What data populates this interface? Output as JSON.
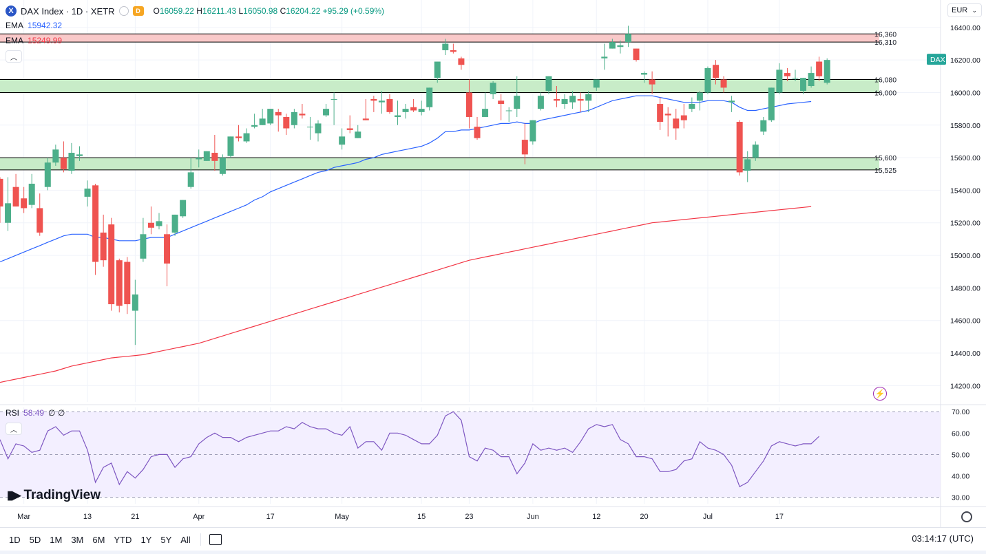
{
  "header": {
    "symbol_icon": "x-badge-icon",
    "title": "DAX Index · 1D · XETR",
    "delay_badge": "D",
    "open_label": "O",
    "open": "16059.22",
    "high_label": "H",
    "high": "16211.43",
    "low_label": "L",
    "low": "16050.98",
    "close_label": "C",
    "close": "16204.22",
    "change": "+95.29 (+0.59%)"
  },
  "legend": {
    "ema_fast_name": "EMA",
    "ema_fast_value": "15942.32",
    "ema_slow_name": "EMA",
    "ema_slow_value": "15249.99",
    "rsi_name": "RSI",
    "rsi_value": "58.49",
    "rsi_extra": "∅ ∅"
  },
  "currency": "EUR",
  "toolbar": {
    "timeframes": [
      "1D",
      "5D",
      "1M",
      "3M",
      "6M",
      "YTD",
      "1Y",
      "5Y",
      "All"
    ],
    "clock": "03:14:17 (UTC)"
  },
  "brand": "TradingView",
  "colors": {
    "up": "#26a69a",
    "up_body": "#4caf8a",
    "down": "#ef5350",
    "ema_fast": "#2962ff",
    "ema_slow": "#f23645",
    "rsi": "#7e57c2",
    "zone_support": "#c8ecc8",
    "zone_resistance": "#f9c9c9"
  },
  "chart_data": {
    "type": "candlestick",
    "ylim": [
      14100,
      16450
    ],
    "yticks": [
      14200,
      14400,
      14600,
      14800,
      15000,
      15200,
      15400,
      15600,
      15800,
      16000,
      16200,
      16400
    ],
    "ytick_labels": [
      "14200.00",
      "14400.00",
      "14600.00",
      "14800.00",
      "15000.00",
      "15200.00",
      "15400.00",
      "15600.00",
      "15800.00",
      "16000.00",
      "16200.00",
      "16400.00"
    ],
    "last_price_tag": "DAX",
    "xtick_labels": [
      "Mar",
      "13",
      "21",
      "Apr",
      "17",
      "May",
      "15",
      "23",
      "Jun",
      "12",
      "20",
      "Jul",
      "17"
    ],
    "xtick_bar_index": [
      3,
      11,
      17,
      25,
      34,
      43,
      53,
      59,
      67,
      75,
      81,
      89,
      98
    ],
    "levels": [
      {
        "label": "16,360",
        "value": 16360
      },
      {
        "label": "16,310",
        "value": 16310
      },
      {
        "label": "16,080",
        "value": 16080
      },
      {
        "label": "16,000",
        "value": 16000
      },
      {
        "label": "15,600",
        "value": 15600
      },
      {
        "label": "15,525",
        "value": 15525
      }
    ],
    "zones": [
      {
        "kind": "resistance",
        "from": 16310,
        "to": 16360
      },
      {
        "kind": "support",
        "from": 16000,
        "to": 16080
      },
      {
        "kind": "support",
        "from": 15525,
        "to": 15600
      }
    ],
    "candles": [
      [
        15470,
        15480,
        15300,
        15200
      ],
      [
        15200,
        15480,
        15320,
        15150
      ],
      [
        15420,
        15500,
        15300,
        15380
      ],
      [
        15350,
        15420,
        15290,
        15260
      ],
      [
        15310,
        15500,
        15440,
        15290
      ],
      [
        15290,
        15380,
        15140,
        15120
      ],
      [
        15420,
        15600,
        15570,
        15400
      ],
      [
        15570,
        15680,
        15650,
        15550
      ],
      [
        15600,
        15700,
        15530,
        15510
      ],
      [
        15520,
        15690,
        15630,
        15500
      ],
      [
        15610,
        15670,
        15620,
        15580
      ],
      [
        15360,
        15460,
        15410,
        15300
      ],
      [
        15430,
        15440,
        14960,
        14880
      ],
      [
        15140,
        15250,
        14970,
        14930
      ],
      [
        15190,
        15230,
        14700,
        14660
      ],
      [
        14970,
        14980,
        14690,
        14650
      ],
      [
        14960,
        14990,
        14700,
        14640
      ],
      [
        14660,
        14850,
        14760,
        14450
      ],
      [
        14980,
        15230,
        15130,
        14960
      ],
      [
        15200,
        15300,
        15170,
        15130
      ],
      [
        15180,
        15260,
        15210,
        15160
      ],
      [
        15130,
        15190,
        14950,
        14810
      ],
      [
        15140,
        15230,
        15250,
        15120
      ],
      [
        15240,
        15320,
        15340,
        15230
      ],
      [
        15420,
        15600,
        15510,
        15410
      ],
      [
        15590,
        15650,
        15600,
        15540
      ],
      [
        15580,
        15610,
        15640,
        15580
      ],
      [
        15630,
        15740,
        15580,
        15520
      ],
      [
        15500,
        15620,
        15600,
        15490
      ],
      [
        15610,
        15680,
        15730,
        15600
      ],
      [
        15730,
        15800,
        15720,
        15700
      ],
      [
        15700,
        15780,
        15750,
        15690
      ],
      [
        15790,
        15870,
        15800,
        15780
      ],
      [
        15800,
        15900,
        15840,
        15810
      ],
      [
        15810,
        15890,
        15900,
        15800
      ],
      [
        15880,
        15900,
        15860,
        15760
      ],
      [
        15850,
        15870,
        15780,
        15740
      ],
      [
        15800,
        15900,
        15880,
        15780
      ],
      [
        15870,
        15930,
        15860,
        15840
      ],
      [
        15790,
        15850,
        15790,
        15710
      ],
      [
        15750,
        15830,
        15810,
        15700
      ],
      [
        15860,
        15930,
        15900,
        15850
      ],
      [
        15960,
        16000,
        15960,
        15800
      ],
      [
        15680,
        15780,
        15730,
        15650
      ],
      [
        15780,
        15860,
        15770,
        15750
      ],
      [
        15720,
        15800,
        15760,
        15720
      ],
      [
        15840,
        15960,
        15830,
        15830
      ],
      [
        15960,
        15980,
        15950,
        15880
      ],
      [
        15940,
        16010,
        15950,
        15870
      ],
      [
        15960,
        15990,
        15880,
        15870
      ],
      [
        15850,
        15950,
        15860,
        15800
      ],
      [
        15880,
        15930,
        15900,
        15840
      ],
      [
        15910,
        15960,
        15890,
        15880
      ],
      [
        15880,
        15950,
        15900,
        15860
      ],
      [
        15910,
        15990,
        16030,
        15890
      ],
      [
        16090,
        16150,
        16190,
        16060
      ],
      [
        16260,
        16330,
        16300,
        16230
      ],
      [
        16260,
        16300,
        16250,
        16240
      ],
      [
        16210,
        16220,
        16170,
        16140
      ],
      [
        16000,
        16080,
        15850,
        15780
      ],
      [
        15790,
        15850,
        15720,
        15710
      ],
      [
        15850,
        16000,
        15900,
        15850
      ],
      [
        15990,
        16070,
        16060,
        15960
      ],
      [
        15950,
        15990,
        15930,
        15830
      ],
      [
        15890,
        15910,
        15890,
        15820
      ],
      [
        15900,
        16100,
        15980,
        15850
      ],
      [
        15710,
        15810,
        15620,
        15560
      ],
      [
        15700,
        15780,
        15830,
        15680
      ],
      [
        15900,
        16000,
        15980,
        15890
      ],
      [
        16010,
        16090,
        16100,
        15990
      ],
      [
        15960,
        16040,
        15950,
        15910
      ],
      [
        15930,
        15990,
        15960,
        15900
      ],
      [
        15940,
        16010,
        15980,
        15900
      ],
      [
        15960,
        16000,
        15950,
        15880
      ],
      [
        15950,
        16010,
        15990,
        15880
      ],
      [
        16030,
        16080,
        16080,
        16010
      ],
      [
        16210,
        16300,
        16220,
        16140
      ],
      [
        16270,
        16330,
        16310,
        16270
      ],
      [
        16280,
        16320,
        16290,
        16240
      ],
      [
        16310,
        16410,
        16360,
        16280
      ],
      [
        16270,
        16260,
        16200,
        16190
      ],
      [
        16110,
        16130,
        16120,
        16060
      ],
      [
        16080,
        16130,
        16050,
        15990
      ],
      [
        15930,
        15970,
        15820,
        15770
      ],
      [
        15870,
        15910,
        15860,
        15730
      ],
      [
        15840,
        15900,
        15780,
        15710
      ],
      [
        15860,
        15930,
        15830,
        15780
      ],
      [
        15900,
        15970,
        15930,
        15880
      ],
      [
        15950,
        16010,
        16000,
        15890
      ],
      [
        16000,
        16160,
        16150,
        15990
      ],
      [
        16170,
        16200,
        16090,
        16050
      ],
      [
        16080,
        16100,
        16030,
        16000
      ],
      [
        15940,
        15980,
        15950,
        15880
      ],
      [
        15820,
        15830,
        15510,
        15490
      ],
      [
        15520,
        15640,
        15590,
        15450
      ],
      [
        15600,
        15700,
        15680,
        15580
      ],
      [
        15760,
        15850,
        15830,
        15740
      ],
      [
        15830,
        16010,
        16030,
        15820
      ],
      [
        16000,
        16180,
        16140,
        15990
      ],
      [
        16120,
        16150,
        16100,
        16070
      ],
      [
        16090,
        16140,
        16090,
        16070
      ],
      [
        16010,
        16080,
        16090,
        15990
      ],
      [
        16040,
        16160,
        16120,
        16030
      ],
      [
        16190,
        16220,
        16100,
        16070
      ],
      [
        16060,
        16210,
        16200,
        16050
      ]
    ],
    "ema_fast": [
      14960,
      14980,
      15000,
      15020,
      15040,
      15060,
      15080,
      15100,
      15120,
      15130,
      15130,
      15130,
      15110,
      15110,
      15100,
      15090,
      15090,
      15090,
      15100,
      15110,
      15110,
      15110,
      15130,
      15150,
      15170,
      15190,
      15210,
      15230,
      15250,
      15270,
      15290,
      15310,
      15340,
      15360,
      15390,
      15410,
      15430,
      15450,
      15470,
      15490,
      15510,
      15520,
      15540,
      15550,
      15560,
      15570,
      15590,
      15600,
      15620,
      15630,
      15640,
      15650,
      15660,
      15670,
      15690,
      15720,
      15760,
      15760,
      15770,
      15770,
      15780,
      15790,
      15800,
      15810,
      15810,
      15820,
      15810,
      15810,
      15830,
      15840,
      15850,
      15860,
      15870,
      15880,
      15890,
      15910,
      15930,
      15950,
      15960,
      15970,
      15980,
      15980,
      15980,
      15970,
      15960,
      15950,
      15940,
      15940,
      15940,
      15950,
      15950,
      15950,
      15940,
      15910,
      15890,
      15890,
      15900,
      15910,
      15920,
      15930,
      15935,
      15940,
      15945,
      15942
    ],
    "ema_slow": [
      14220,
      14230,
      14240,
      14250,
      14260,
      14270,
      14280,
      14290,
      14305,
      14320,
      14330,
      14340,
      14350,
      14360,
      14370,
      14375,
      14380,
      14385,
      14390,
      14400,
      14410,
      14420,
      14430,
      14440,
      14450,
      14460,
      14475,
      14490,
      14505,
      14520,
      14535,
      14550,
      14565,
      14580,
      14595,
      14610,
      14625,
      14640,
      14655,
      14670,
      14685,
      14700,
      14715,
      14730,
      14745,
      14760,
      14775,
      14790,
      14805,
      14820,
      14835,
      14850,
      14865,
      14880,
      14895,
      14910,
      14925,
      14940,
      14955,
      14970,
      14980,
      14990,
      15000,
      15010,
      15020,
      15030,
      15040,
      15050,
      15060,
      15070,
      15080,
      15090,
      15100,
      15110,
      15120,
      15130,
      15140,
      15150,
      15160,
      15170,
      15180,
      15190,
      15200,
      15205,
      15210,
      15215,
      15220,
      15225,
      15230,
      15235,
      15240,
      15245,
      15250,
      15255,
      15260,
      15265,
      15270,
      15275,
      15280,
      15285,
      15290,
      15295,
      15300,
      15249.99
    ],
    "rsi": {
      "ylim": [
        27,
        72
      ],
      "yticks": [
        30,
        40,
        50,
        60,
        70
      ],
      "ytick_labels": [
        "30.00",
        "40.00",
        "50.00",
        "60.00",
        "70.00"
      ],
      "upper_band": 70,
      "mid_band": 50,
      "lower_band": 30,
      "values": [
        57,
        48,
        55,
        54,
        51,
        52,
        61,
        63,
        59,
        61,
        61,
        52,
        37,
        44,
        46,
        36,
        42,
        39,
        43,
        49,
        50,
        50,
        44,
        48,
        49,
        55,
        58,
        60,
        58,
        58,
        56,
        58,
        59,
        60,
        61,
        61,
        63,
        62,
        65,
        63,
        62,
        62,
        60,
        59,
        63,
        53,
        56,
        56,
        52,
        60,
        60,
        59,
        57,
        55,
        55,
        59,
        68,
        70,
        66,
        49,
        47,
        53,
        52,
        49,
        49,
        41,
        46,
        55,
        52,
        53,
        52,
        53,
        51,
        56,
        62,
        64,
        63,
        64,
        57,
        55,
        49,
        49,
        48,
        42,
        42,
        43,
        47,
        48,
        56,
        53,
        52,
        50,
        45,
        35,
        37,
        42,
        47,
        54,
        56,
        55,
        54,
        55,
        55,
        58.49
      ]
    }
  }
}
